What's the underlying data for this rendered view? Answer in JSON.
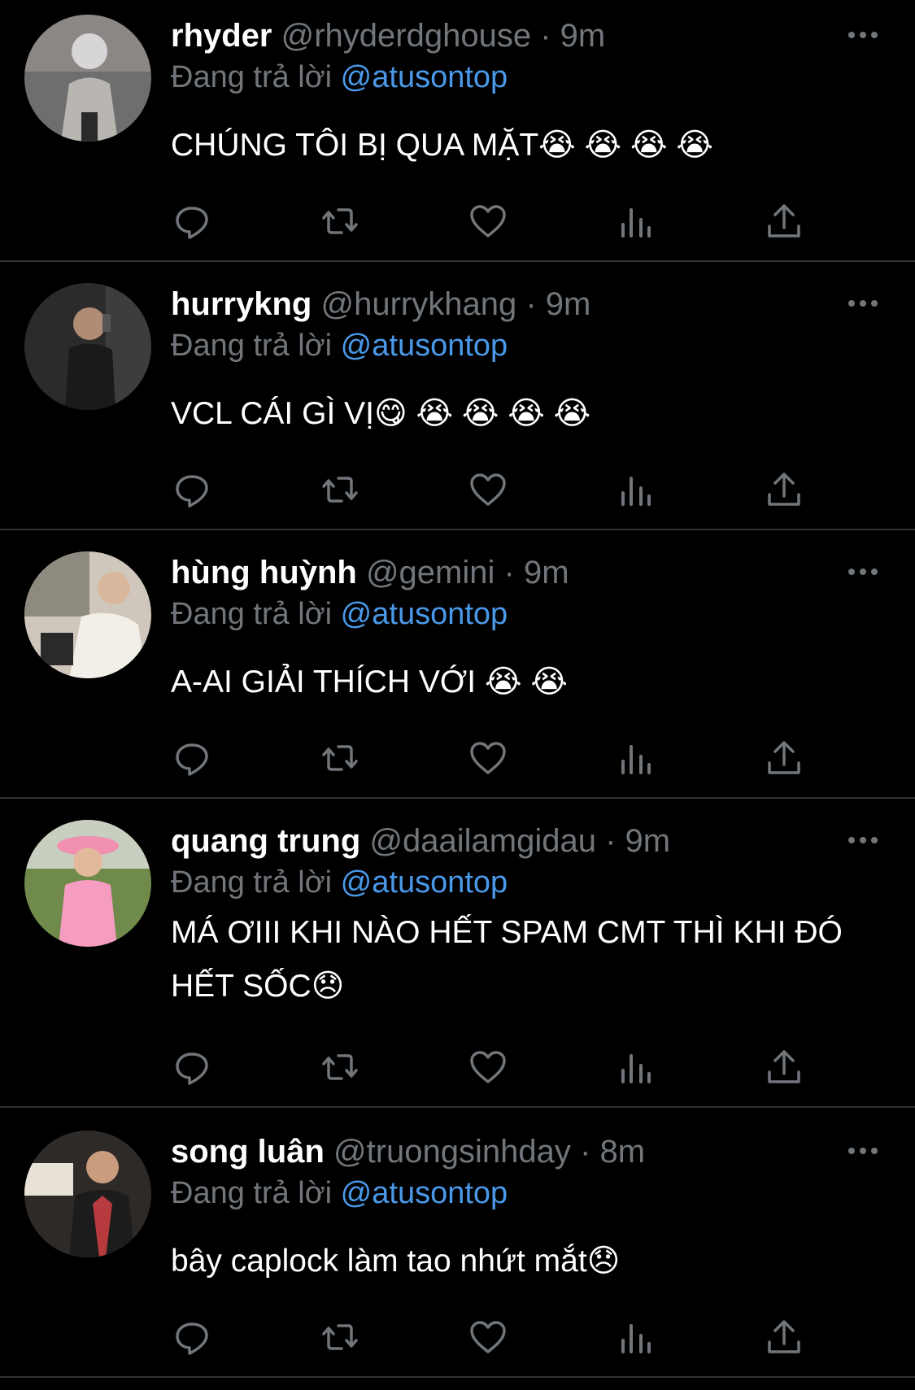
{
  "reply_prefix": "Đang trả lời",
  "colors": {
    "background": "#000000",
    "muted": "#71767b",
    "link": "#4a99e9",
    "divider": "#2f3336"
  },
  "tweets": [
    {
      "name": "rhyder",
      "handle": "@rhyderdghouse",
      "sep": "·",
      "time": "9m",
      "reply_to": "@atusontop",
      "text": "CHÚNG TÔI BỊ QUA MẶT😭 😭 😭 😭",
      "avatar_icon": "person-photo-avatar"
    },
    {
      "name": "hurrykng",
      "handle": "@hurrykhang",
      "sep": "·",
      "time": "9m",
      "reply_to": "@atusontop",
      "text": "VCL CÁI GÌ VỊ😋 😭 😭 😭 😭",
      "avatar_icon": "person-photo-avatar"
    },
    {
      "name": "hùng huỳnh",
      "handle": "@gemini",
      "sep": "·",
      "time": "9m",
      "reply_to": "@atusontop",
      "text": "A-AI GIẢI THÍCH VỚI 😭 😭",
      "avatar_icon": "person-photo-avatar"
    },
    {
      "name": "quang trung",
      "handle": "@daailamgidau",
      "sep": "·",
      "time": "9m",
      "reply_to": "@atusontop",
      "text": "MÁ ƠIII KHI NÀO HẾT SPAM CMT THÌ KHI ĐÓ HẾT SỐC😞",
      "avatar_icon": "person-photo-avatar"
    },
    {
      "name": "song luân",
      "handle": "@truongsinhday",
      "sep": "·",
      "time": "8m",
      "reply_to": "@atusontop",
      "text": "bây caplock làm tao nhứt mắt😞",
      "avatar_icon": "person-photo-avatar"
    }
  ],
  "action_icons": [
    "reply-icon",
    "retweet-icon",
    "like-icon",
    "views-icon",
    "share-icon"
  ]
}
